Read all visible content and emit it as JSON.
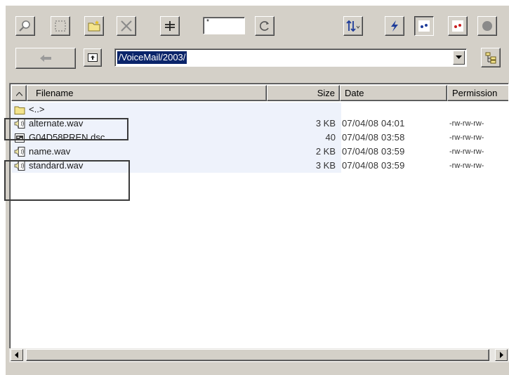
{
  "toolbar": {
    "buttons": [
      {
        "name": "find-icon",
        "title": "Find"
      },
      {
        "name": "select-all-icon",
        "title": "Select all"
      },
      {
        "name": "new-folder-icon",
        "title": "New folder"
      },
      {
        "name": "delete-icon",
        "title": "Delete"
      },
      {
        "name": "filter-icon",
        "title": "Filter"
      }
    ],
    "filter_mask": "*",
    "right_buttons": [
      {
        "name": "sort-icon"
      },
      {
        "name": "lightning-icon"
      },
      {
        "name": "blue-dots-icon"
      },
      {
        "name": "red-dots-icon"
      },
      {
        "name": "stop-icon"
      }
    ]
  },
  "nav": {
    "path": "/VoiceMail/2003/"
  },
  "columns": {
    "filename": "Filename",
    "size": "Size",
    "date": "Date",
    "permission": "Permission"
  },
  "files": [
    {
      "icon": "folder-icon",
      "name": "<..>",
      "size": "",
      "date": "",
      "perm": ""
    },
    {
      "icon": "wav-file-icon",
      "name": "alternate.wav",
      "size": "3 KB",
      "date": "07/04/08  04:01",
      "perm": "-rw-rw-rw-"
    },
    {
      "icon": "dsc-file-icon",
      "name": "G04D58PREN.dsc",
      "size": "40",
      "date": "07/04/08  03:58",
      "perm": "-rw-rw-rw-"
    },
    {
      "icon": "wav-file-icon",
      "name": "name.wav",
      "size": "2 KB",
      "date": "07/04/08  03:59",
      "perm": "-rw-rw-rw-"
    },
    {
      "icon": "wav-file-icon",
      "name": "standard.wav",
      "size": "3 KB",
      "date": "07/04/08  03:59",
      "perm": "-rw-rw-rw-"
    }
  ]
}
